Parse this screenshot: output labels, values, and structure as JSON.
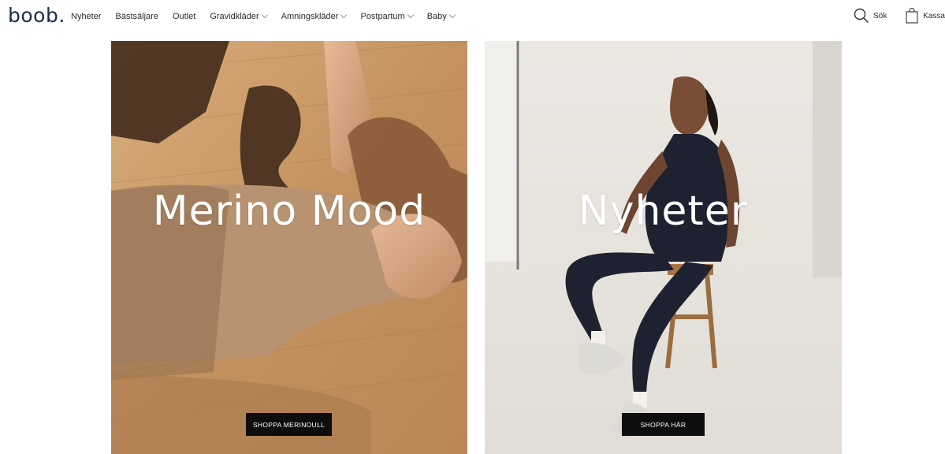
{
  "header": {
    "logo": "boob",
    "logo_dot": ".",
    "nav": [
      {
        "label": "Nyheter",
        "dropdown": false
      },
      {
        "label": "Bästsäljare",
        "dropdown": false
      },
      {
        "label": "Outlet",
        "dropdown": false
      },
      {
        "label": "Gravidkläder",
        "dropdown": true
      },
      {
        "label": "Amningskläder",
        "dropdown": true
      },
      {
        "label": "Postpartum",
        "dropdown": true
      },
      {
        "label": "Baby",
        "dropdown": true
      }
    ],
    "search_label": "Sök",
    "cart_label": "Kassa",
    "icons": {
      "search": "search-icon",
      "cart": "shopping-bag-icon",
      "dropdown": "chevron-down-icon"
    }
  },
  "hero": {
    "left": {
      "title": "Merino Mood",
      "cta": "SHOPPA MERINOULL"
    },
    "right": {
      "title": "Nyheter",
      "cta": "SHOPPA HÄR"
    }
  },
  "colors": {
    "brand": "#1e2c43",
    "button_bg": "#0d0d0d",
    "button_text": "#ffffff",
    "left_photo_tone": "#c99a6a",
    "right_photo_tone": "#e8e5df"
  }
}
